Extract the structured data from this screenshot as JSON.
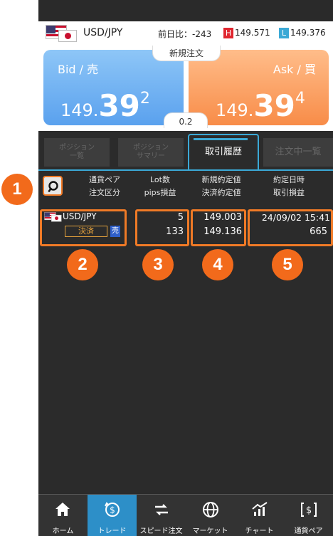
{
  "pair_bar": {
    "pair": "USD/JPY",
    "prev_day_label": "前日比：",
    "prev_day_value": "-243",
    "high_badge": "H",
    "high_value": "149.571",
    "low_badge": "L",
    "low_value": "149.376"
  },
  "quote": {
    "new_order_label": "新規注文",
    "bid_label": "Bid / 売",
    "bid_price_prefix": "149.",
    "bid_price_main": "39",
    "bid_price_sup": "2",
    "ask_label": "Ask / 買",
    "ask_price_prefix": "149.",
    "ask_price_main": "39",
    "ask_price_sup": "4",
    "spread": "0.2"
  },
  "tabs": [
    {
      "line1": "ポジション",
      "line2": "一覧"
    },
    {
      "line1": "ポジション",
      "line2": "サマリー"
    },
    {
      "label": "取引履歴"
    },
    {
      "label": "注文中一覧"
    }
  ],
  "columns": {
    "c1_line1": "通貨ペア",
    "c1_line2": "注文区分",
    "c2_line1": "Lot数",
    "c2_line2": "pips損益",
    "c3_line1": "新規約定値",
    "c3_line2": "決済約定値",
    "c4_line1": "約定日時",
    "c4_line2": "取引損益"
  },
  "row": {
    "pair": "USD/JPY",
    "order_type": "決済",
    "side": "売",
    "lots": "5",
    "pips": "133",
    "open_price": "149.003",
    "close_price": "149.136",
    "datetime": "24/09/02 15:41",
    "pnl": "665"
  },
  "markers": [
    "1",
    "2",
    "3",
    "4",
    "5"
  ],
  "nav": [
    "ホーム",
    "トレード",
    "スピード注文",
    "マーケット",
    "チャート",
    "通貨ペア"
  ],
  "colors": {
    "accent": "#3ba9d6",
    "marker": "#f26a1b",
    "bid": "#5aa1ee",
    "ask": "#f88c48"
  }
}
